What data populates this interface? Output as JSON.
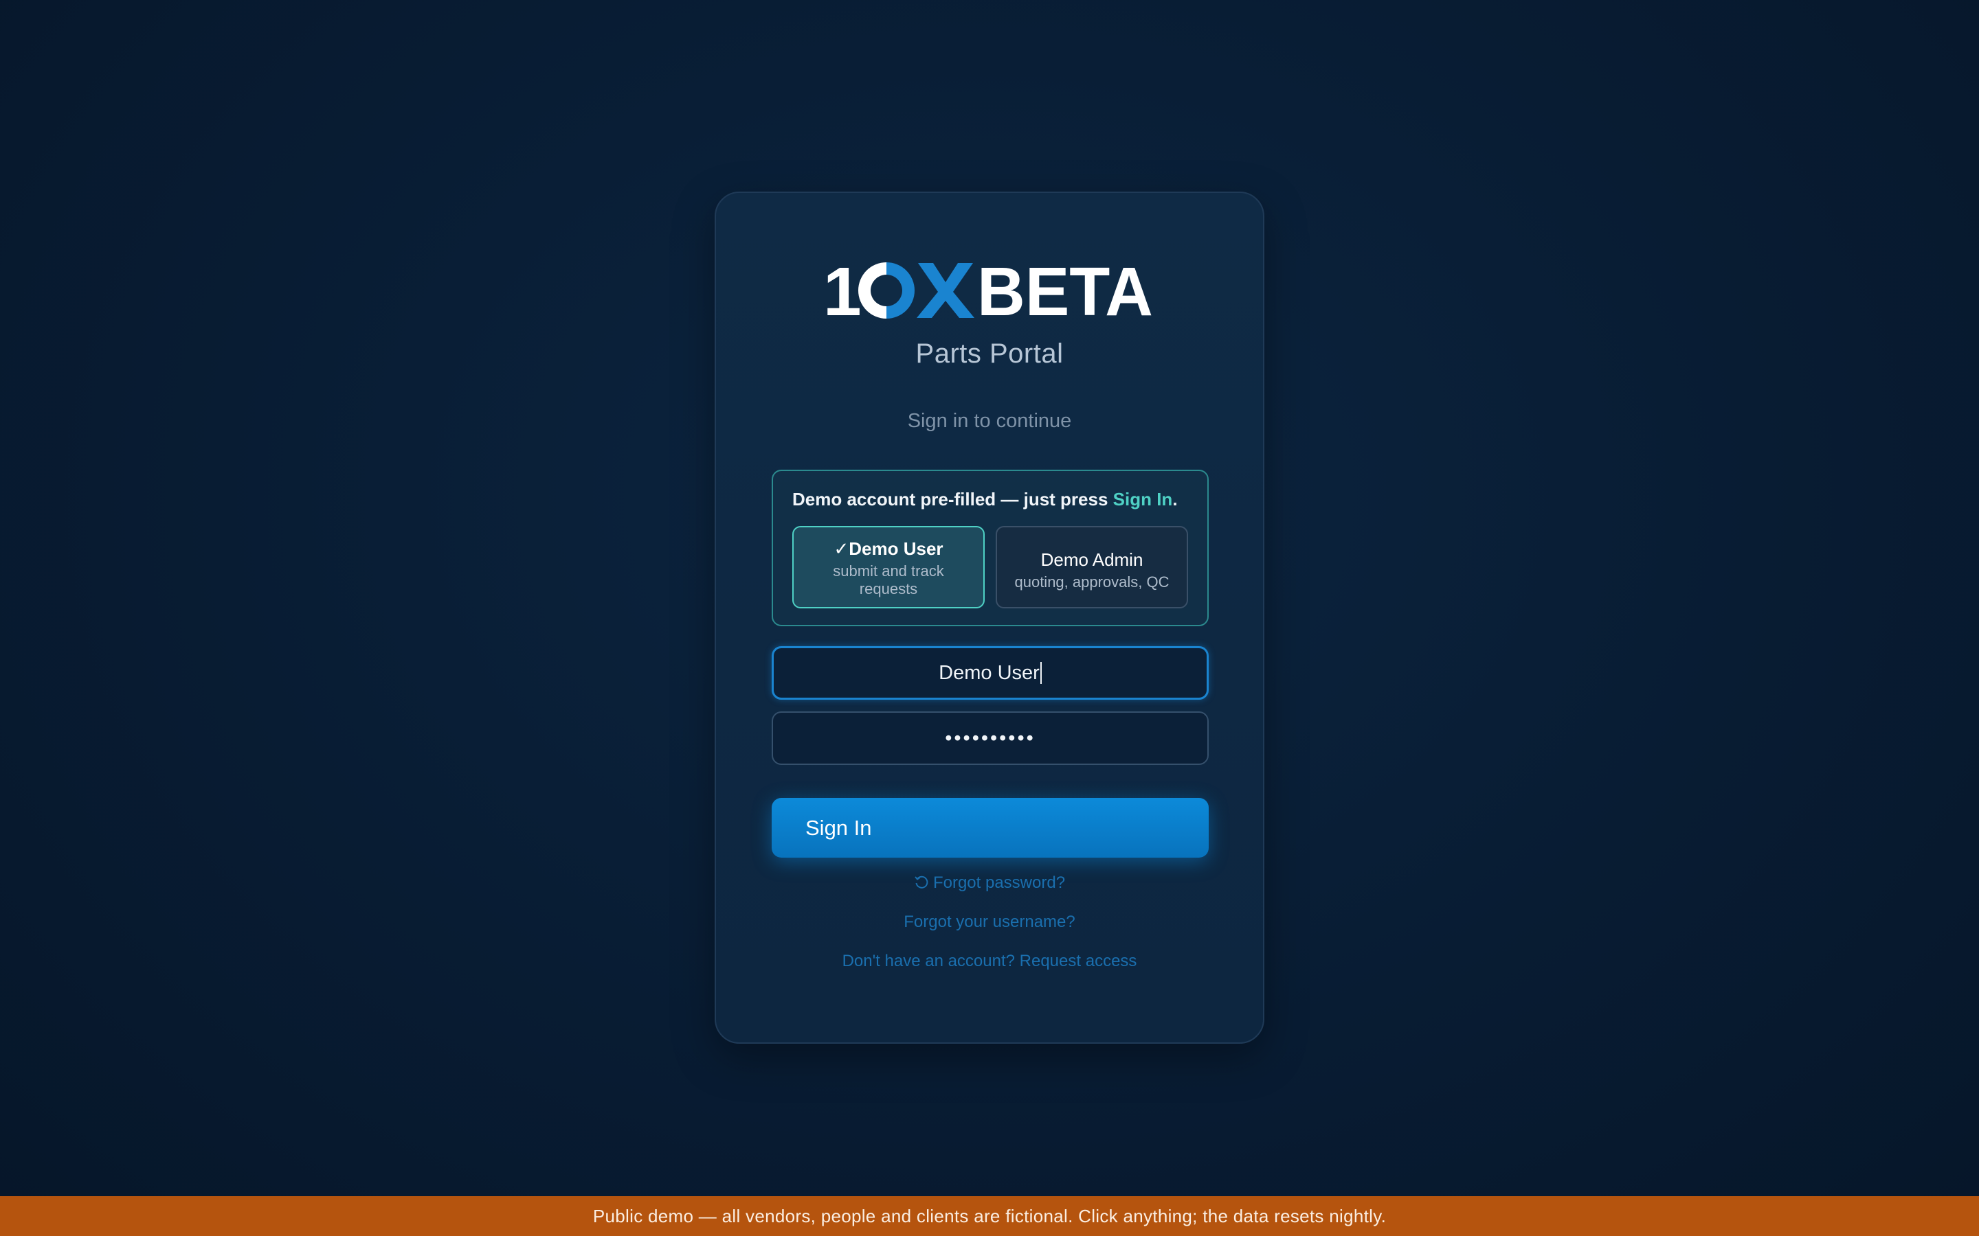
{
  "brand": {
    "logo_text": "10XBETA",
    "portal_name": "Parts Portal",
    "accent_color": "#1a84d0"
  },
  "login": {
    "subtitle": "Sign in to continue",
    "demo_note_prefix": "Demo account pre-filled — just press ",
    "demo_note_link": "Sign In",
    "demo_note_suffix": ".",
    "choices": [
      {
        "check": "✓",
        "title": "Demo User",
        "desc": "submit and track requests",
        "selected": true
      },
      {
        "title": "Demo Admin",
        "desc": "quoting, approvals, QC",
        "selected": false
      }
    ],
    "username_value": "Demo User",
    "password_mask": "••••••••••",
    "signin_label": "Sign In",
    "forgot_password": "Forgot password?",
    "forgot_username": "Forgot your username?",
    "request_access": "Don't have an account? Request access"
  },
  "banner": {
    "text": "Public demo — all vendors, people and clients are fictional. Click anything; the data resets nightly.",
    "color": "#b5540e"
  }
}
